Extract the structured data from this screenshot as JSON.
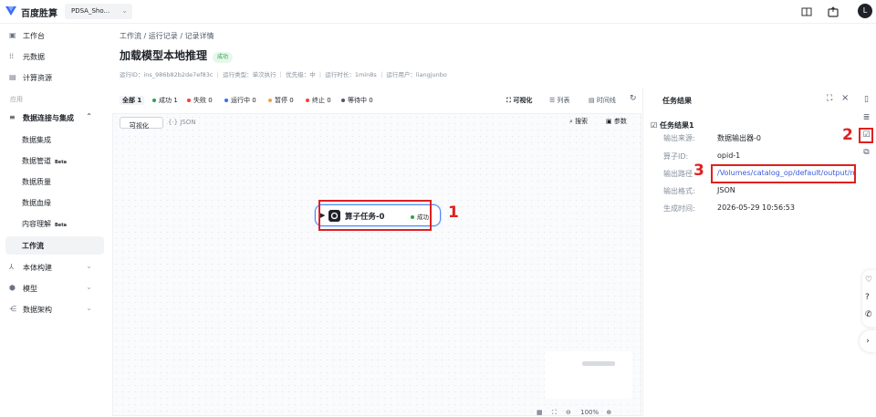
{
  "topbar": {
    "logo_text": "百度胜算",
    "workspace": "PDSA_Sho...",
    "avatar_letter": "L",
    "icons": [
      "book-icon",
      "export-icon"
    ]
  },
  "sidebar": {
    "items": [
      {
        "label": "工作台",
        "icon": "workbench-icon"
      },
      {
        "label": "元数据",
        "icon": "metadata-icon"
      },
      {
        "label": "计算资源",
        "icon": "compute-icon"
      }
    ],
    "section_label": "应用",
    "group": {
      "label": "数据连接与集成",
      "icon": "database-icon"
    },
    "sub_items": [
      {
        "label": "数据集成",
        "beta": ""
      },
      {
        "label": "数据管道",
        "beta": "Beta"
      },
      {
        "label": "数据质量",
        "beta": ""
      },
      {
        "label": "数据血缘",
        "beta": ""
      },
      {
        "label": "内容理解",
        "beta": "Beta"
      },
      {
        "label": "工作流",
        "beta": ""
      }
    ],
    "bottom_items": [
      {
        "label": "本体构建",
        "icon": "ontology-icon"
      },
      {
        "label": "模型",
        "icon": "model-icon"
      },
      {
        "label": "数据架构",
        "icon": "architecture-icon"
      }
    ]
  },
  "main": {
    "breadcrumb": "工作流 / 运行记录 / 记录详情",
    "title": "加载模型本地推理",
    "status": "成功",
    "meta": "运行ID：ins_986b82b2de7ef83c ｜ 运行类型：单次执行 ｜ 优先级：中 ｜ 运行时长：1min8s ｜ 运行用户：liangjunbo",
    "filters": [
      {
        "label": "全部 1",
        "color": ""
      },
      {
        "label": "成功 1",
        "color": "#2aa44a"
      },
      {
        "label": "失败 0",
        "color": "#f53f3f"
      },
      {
        "label": "运行中 0",
        "color": "#3b6cf6"
      },
      {
        "label": "暂停 0",
        "color": "#f7a23b"
      },
      {
        "label": "终止 0",
        "color": "#f53f3f"
      },
      {
        "label": "等待中 0",
        "color": "#4e5969"
      }
    ],
    "view_tabs": [
      "可视化",
      "列表",
      "时间线"
    ],
    "canvas_tabs": [
      "可视化",
      "JSON"
    ],
    "search_label": "搜索",
    "params_label": "参数",
    "node": {
      "label": "算子任务-0",
      "status": "成功"
    },
    "zoom": "100%"
  },
  "panel": {
    "title": "任务结果",
    "result_title": "任务结果1",
    "fields": [
      {
        "key": "输出来源:",
        "value": "数据输出器-0"
      },
      {
        "key": "算子ID:",
        "value": "opid-1"
      },
      {
        "key": "输出路径",
        "value": "/Volumes/catalog_op/default/output/mode"
      },
      {
        "key": "输出格式:",
        "value": "JSON"
      },
      {
        "key": "生成时间:",
        "value": "2026-05-29 10:56:53"
      }
    ]
  },
  "annotations": [
    "1",
    "2",
    "3"
  ],
  "colors": {
    "accent": "#3b6cf6",
    "success": "#2aa44a",
    "annotation": "#e02020"
  }
}
